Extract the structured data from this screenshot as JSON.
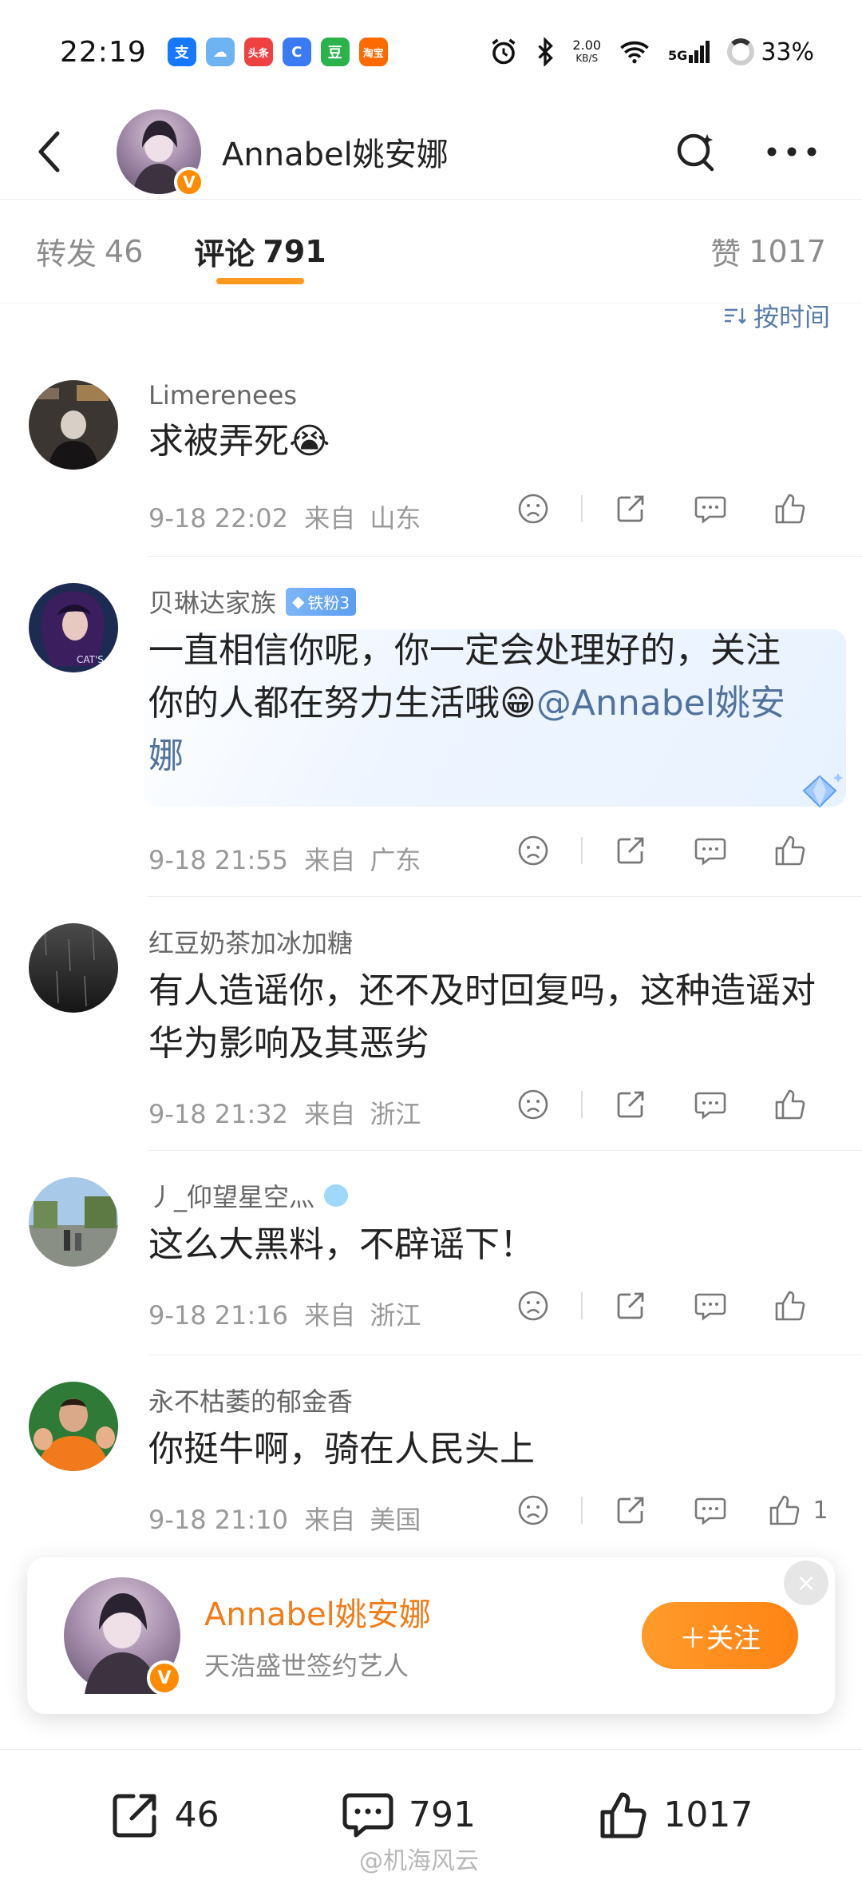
{
  "status_bar": {
    "time": "22:19",
    "app_icons": [
      {
        "glyph": "支",
        "color": "#1677ff"
      },
      {
        "glyph": "☁",
        "color": "#6fb4f2"
      },
      {
        "glyph": "头条",
        "color": "#f04142"
      },
      {
        "glyph": "C",
        "color": "#3a7bf5"
      },
      {
        "glyph": "豆",
        "color": "#2ab24b"
      },
      {
        "glyph": "淘宝",
        "color": "#ff6a00"
      }
    ],
    "net_speed_value": "2.00",
    "net_speed_unit": "KB/S",
    "network": "5G",
    "battery": "33%"
  },
  "header": {
    "title": "Annabel姚安娜"
  },
  "tabs": {
    "repost_label": "转发",
    "repost_count": "46",
    "comment_label": "评论",
    "comment_count": "791",
    "like_label": "赞",
    "like_count": "1017"
  },
  "sort": {
    "label": "按时间"
  },
  "comments": [
    {
      "name": "Limerenees",
      "text": "求被弄死😭",
      "time": "9-18 22:02",
      "from": "来自",
      "location": "山东"
    },
    {
      "name": "贝琳达家族",
      "badge": "铁粉3",
      "text": "一直相信你呢，你一定会处理好的，关注你的人都在努力生活哦😁",
      "mention": "@Annabel姚安娜",
      "time": "9-18 21:55",
      "from": "来自",
      "location": "广东"
    },
    {
      "name": "红豆奶茶加冰加糖",
      "text": "有人造谣你，还不及时回复吗，这种造谣对华为影响及其恶劣",
      "time": "9-18 21:32",
      "from": "来自",
      "location": "浙江"
    },
    {
      "name": "丿_仰望星空灬",
      "text": "这么大黑料，不辟谣下！",
      "time": "9-18 21:16",
      "from": "来自",
      "location": "浙江"
    },
    {
      "name": "永不枯萎的郁金香",
      "text": "你挺牛啊，骑在人民头上",
      "time": "9-18 21:10",
      "from": "来自",
      "location": "美国",
      "likes": "1"
    }
  ],
  "follow_card": {
    "name": "Annabel姚安娜",
    "subtitle": "天浩盛世签约艺人",
    "button": "＋关注",
    "close": "×"
  },
  "bottom_bar": {
    "reposts": "46",
    "comments": "791",
    "likes": "1017"
  },
  "watermark": "@机海风云",
  "colors": {
    "accent": "#ff8c00",
    "tab_indicator": "#ff9a1f",
    "link": "#51729e",
    "follow_name": "#f07c1a"
  }
}
